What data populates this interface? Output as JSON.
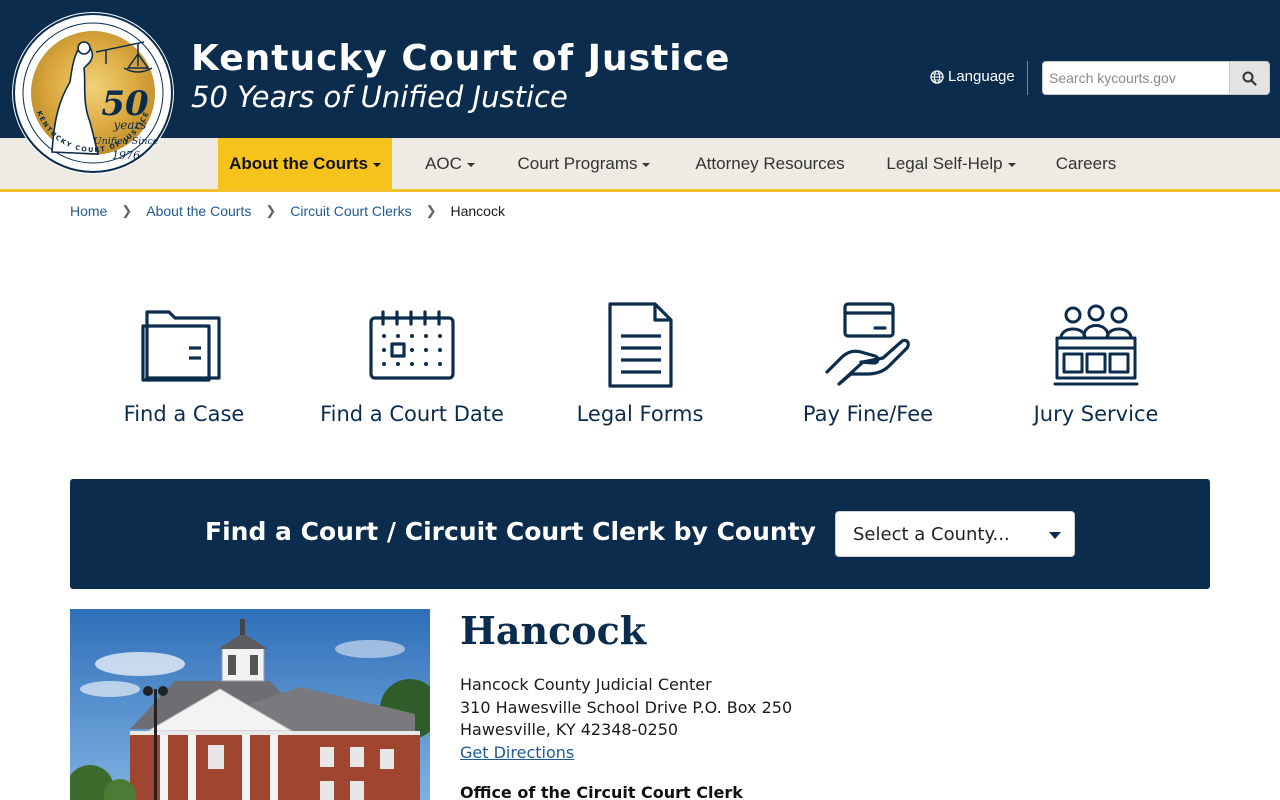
{
  "header": {
    "title": "Kentucky Court of Justice",
    "subtitle": "50 Years of Unified Justice",
    "language_label": "Language",
    "search_placeholder": "Search kycourts.gov",
    "seal": {
      "years_number": "50",
      "years_word": "years",
      "unified_since": "Unified Since",
      "year": "1976",
      "ring_text": "KENTUCKY COURT OF JUSTICE"
    }
  },
  "nav": {
    "items": [
      {
        "label": "About the Courts",
        "active": true,
        "dropdown": true
      },
      {
        "label": "AOC",
        "active": false,
        "dropdown": true
      },
      {
        "label": "Court Programs",
        "active": false,
        "dropdown": true
      },
      {
        "label": "Attorney Resources",
        "active": false,
        "dropdown": false
      },
      {
        "label": "Legal Self-Help",
        "active": false,
        "dropdown": true
      },
      {
        "label": "Careers",
        "active": false,
        "dropdown": false
      }
    ]
  },
  "breadcrumb": {
    "items": [
      "Home",
      "About the Courts",
      "Circuit Court Clerks"
    ],
    "current": "Hancock"
  },
  "quick_links": [
    {
      "label": "Find a Case",
      "icon": "folder-icon"
    },
    {
      "label": "Find a Court Date",
      "icon": "calendar-icon"
    },
    {
      "label": "Legal Forms",
      "icon": "document-icon"
    },
    {
      "label": "Pay Fine/Fee",
      "icon": "hand-card-icon"
    },
    {
      "label": "Jury Service",
      "icon": "jury-box-icon"
    }
  ],
  "finder": {
    "title": "Find a Court / Circuit Court Clerk by County",
    "select_value": "Select a County..."
  },
  "county": {
    "name": "Hancock",
    "address_line1": "Hancock County Judicial Center",
    "address_line2": "310 Hawesville School Drive P.O. Box 250",
    "address_line3": "Hawesville, KY 42348-0250",
    "directions_label": "Get Directions",
    "office_heading": "Office of the Circuit Court Clerk"
  },
  "colors": {
    "navy": "#0b2c4d",
    "gold": "#f6c31c",
    "nav_bg": "#eeebe4",
    "link": "#1f5a94"
  }
}
